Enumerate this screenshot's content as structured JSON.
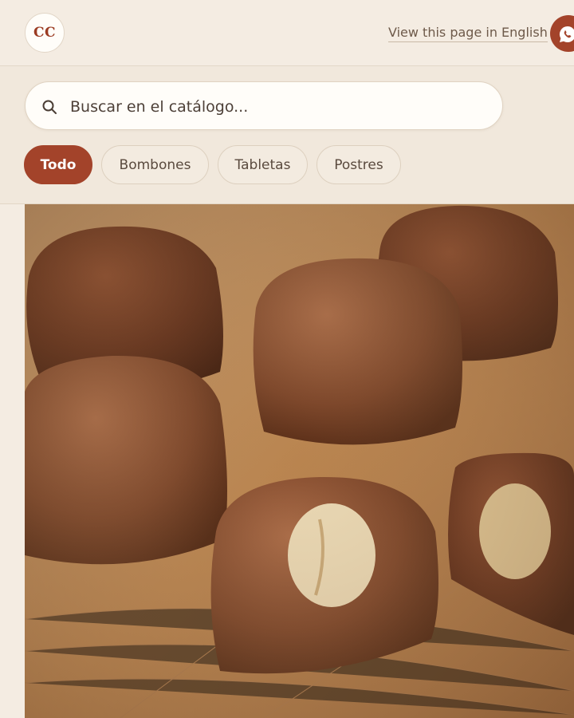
{
  "header": {
    "logo_text": "CC",
    "language_link": "View this page in English",
    "chat_icon": "whatsapp-icon",
    "accent_color": "#a3432a"
  },
  "search": {
    "placeholder": "Buscar en el catálogo...",
    "icon": "search-icon"
  },
  "categories": [
    {
      "label": "Todo",
      "active": true
    },
    {
      "label": "Bombones",
      "active": false
    },
    {
      "label": "Tabletas",
      "active": false
    },
    {
      "label": "Postres",
      "active": false
    }
  ],
  "hero_image": {
    "subject": "chocolate bonbons with hazelnut filling on a wooden board"
  }
}
